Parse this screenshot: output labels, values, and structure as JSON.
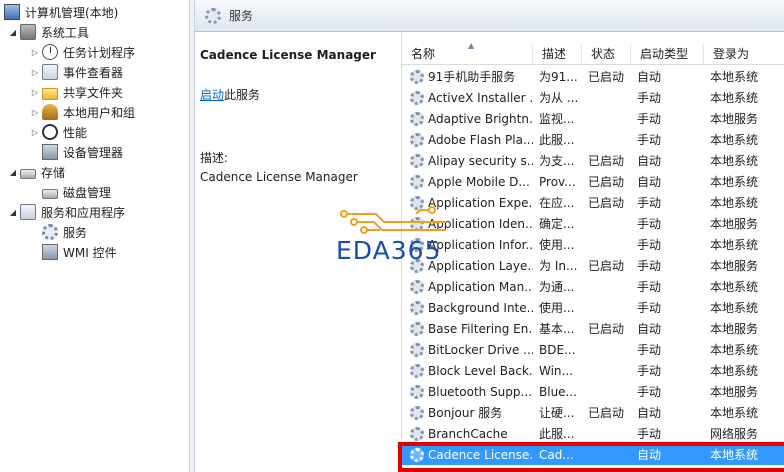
{
  "tree": {
    "root": "计算机管理(本地)",
    "system_tools": "系统工具",
    "task_scheduler": "任务计划程序",
    "event_viewer": "事件查看器",
    "shared_folders": "共享文件夹",
    "local_users": "本地用户和组",
    "performance": "性能",
    "device_manager": "设备管理器",
    "storage": "存储",
    "disk_management": "磁盘管理",
    "services_apps": "服务和应用程序",
    "services": "服务",
    "wmi": "WMI 控件"
  },
  "header": {
    "title": "服务"
  },
  "details": {
    "service_name": "Cadence License Manager",
    "action_link": "启动",
    "action_suffix": "此服务",
    "desc_label": "描述:",
    "desc_text": "Cadence License Manager"
  },
  "columns": {
    "name": "名称",
    "desc": "描述",
    "status": "状态",
    "startup": "启动类型",
    "logon": "登录为"
  },
  "rows": [
    {
      "name": "91手机助手服务",
      "desc": "为91...",
      "status": "已启动",
      "startup": "自动",
      "logon": "本地系统"
    },
    {
      "name": "ActiveX Installer ...",
      "desc": "为从 ...",
      "status": "",
      "startup": "手动",
      "logon": "本地系统"
    },
    {
      "name": "Adaptive Brightn...",
      "desc": "监视...",
      "status": "",
      "startup": "手动",
      "logon": "本地服务"
    },
    {
      "name": "Adobe Flash Pla...",
      "desc": "此服...",
      "status": "",
      "startup": "手动",
      "logon": "本地系统"
    },
    {
      "name": "Alipay security s...",
      "desc": "为支...",
      "status": "已启动",
      "startup": "自动",
      "logon": "本地系统"
    },
    {
      "name": "Apple Mobile D...",
      "desc": "Prov...",
      "status": "已启动",
      "startup": "自动",
      "logon": "本地系统"
    },
    {
      "name": "Application Expe...",
      "desc": "在应...",
      "status": "已启动",
      "startup": "手动",
      "logon": "本地系统"
    },
    {
      "name": "Application Iden...",
      "desc": "确定...",
      "status": "",
      "startup": "手动",
      "logon": "本地服务"
    },
    {
      "name": "Application Infor...",
      "desc": "使用...",
      "status": "",
      "startup": "手动",
      "logon": "本地系统"
    },
    {
      "name": "Application Laye...",
      "desc": "为 In...",
      "status": "已启动",
      "startup": "手动",
      "logon": "本地服务"
    },
    {
      "name": "Application Man...",
      "desc": "为通...",
      "status": "",
      "startup": "手动",
      "logon": "本地系统"
    },
    {
      "name": "Background Inte...",
      "desc": "使用...",
      "status": "",
      "startup": "手动",
      "logon": "本地系统"
    },
    {
      "name": "Base Filtering En...",
      "desc": "基本...",
      "status": "已启动",
      "startup": "自动",
      "logon": "本地服务"
    },
    {
      "name": "BitLocker Drive ...",
      "desc": "BDE...",
      "status": "",
      "startup": "手动",
      "logon": "本地系统"
    },
    {
      "name": "Block Level Back...",
      "desc": "Win...",
      "status": "",
      "startup": "手动",
      "logon": "本地系统"
    },
    {
      "name": "Bluetooth Supp...",
      "desc": "Blue...",
      "status": "",
      "startup": "手动",
      "logon": "本地服务"
    },
    {
      "name": "Bonjour 服务",
      "desc": "让硬...",
      "status": "已启动",
      "startup": "自动",
      "logon": "本地系统"
    },
    {
      "name": "BranchCache",
      "desc": "此服...",
      "status": "",
      "startup": "手动",
      "logon": "网络服务"
    },
    {
      "name": "Cadence License...",
      "desc": "Cad...",
      "status": "",
      "startup": "自动",
      "logon": "本地系统"
    }
  ],
  "watermark": {
    "text": "EDA365"
  },
  "colors": {
    "selection": "#3399ff",
    "highlight_box": "#e00000",
    "link": "#0066cc",
    "watermark": "#1a4fa8"
  }
}
